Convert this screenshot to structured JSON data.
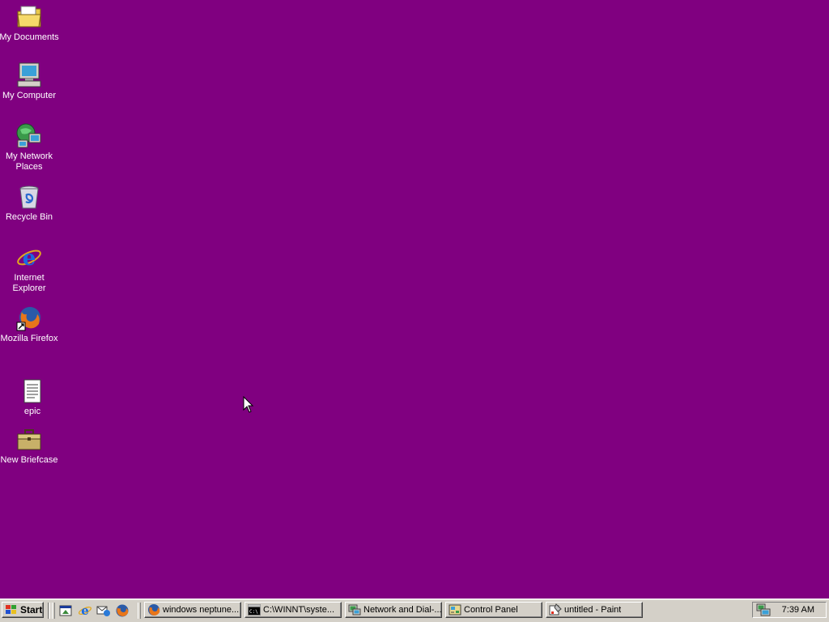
{
  "desktop": {
    "background": "#800080",
    "icons": [
      {
        "label": "My Documents",
        "icon": "folder-documents-icon"
      },
      {
        "label": "My Computer",
        "icon": "computer-icon"
      },
      {
        "label": "My Network Places",
        "icon": "network-places-icon"
      },
      {
        "label": "Recycle Bin",
        "icon": "recycle-bin-icon"
      },
      {
        "label": "Internet Explorer",
        "icon": "internet-explorer-icon"
      },
      {
        "label": "Mozilla Firefox",
        "icon": "firefox-icon"
      },
      {
        "label": "epic",
        "icon": "text-document-icon"
      },
      {
        "label": "New Briefcase",
        "icon": "briefcase-icon"
      }
    ]
  },
  "taskbar": {
    "start_label": "Start",
    "quick_launch": [
      {
        "icon": "show-desktop-icon"
      },
      {
        "icon": "internet-explorer-icon"
      },
      {
        "icon": "outlook-express-icon"
      },
      {
        "icon": "firefox-icon"
      }
    ],
    "tasks": [
      {
        "label": "windows neptune...",
        "icon": "firefox-icon"
      },
      {
        "label": "C:\\WINNT\\syste...",
        "icon": "command-prompt-icon"
      },
      {
        "label": "Network and Dial-...",
        "icon": "network-connections-icon"
      },
      {
        "label": "Control Panel",
        "icon": "control-panel-icon"
      },
      {
        "label": "untitled - Paint",
        "icon": "paint-icon"
      }
    ],
    "tray": {
      "icon": "network-tray-icon",
      "clock": "7:39 AM"
    }
  }
}
